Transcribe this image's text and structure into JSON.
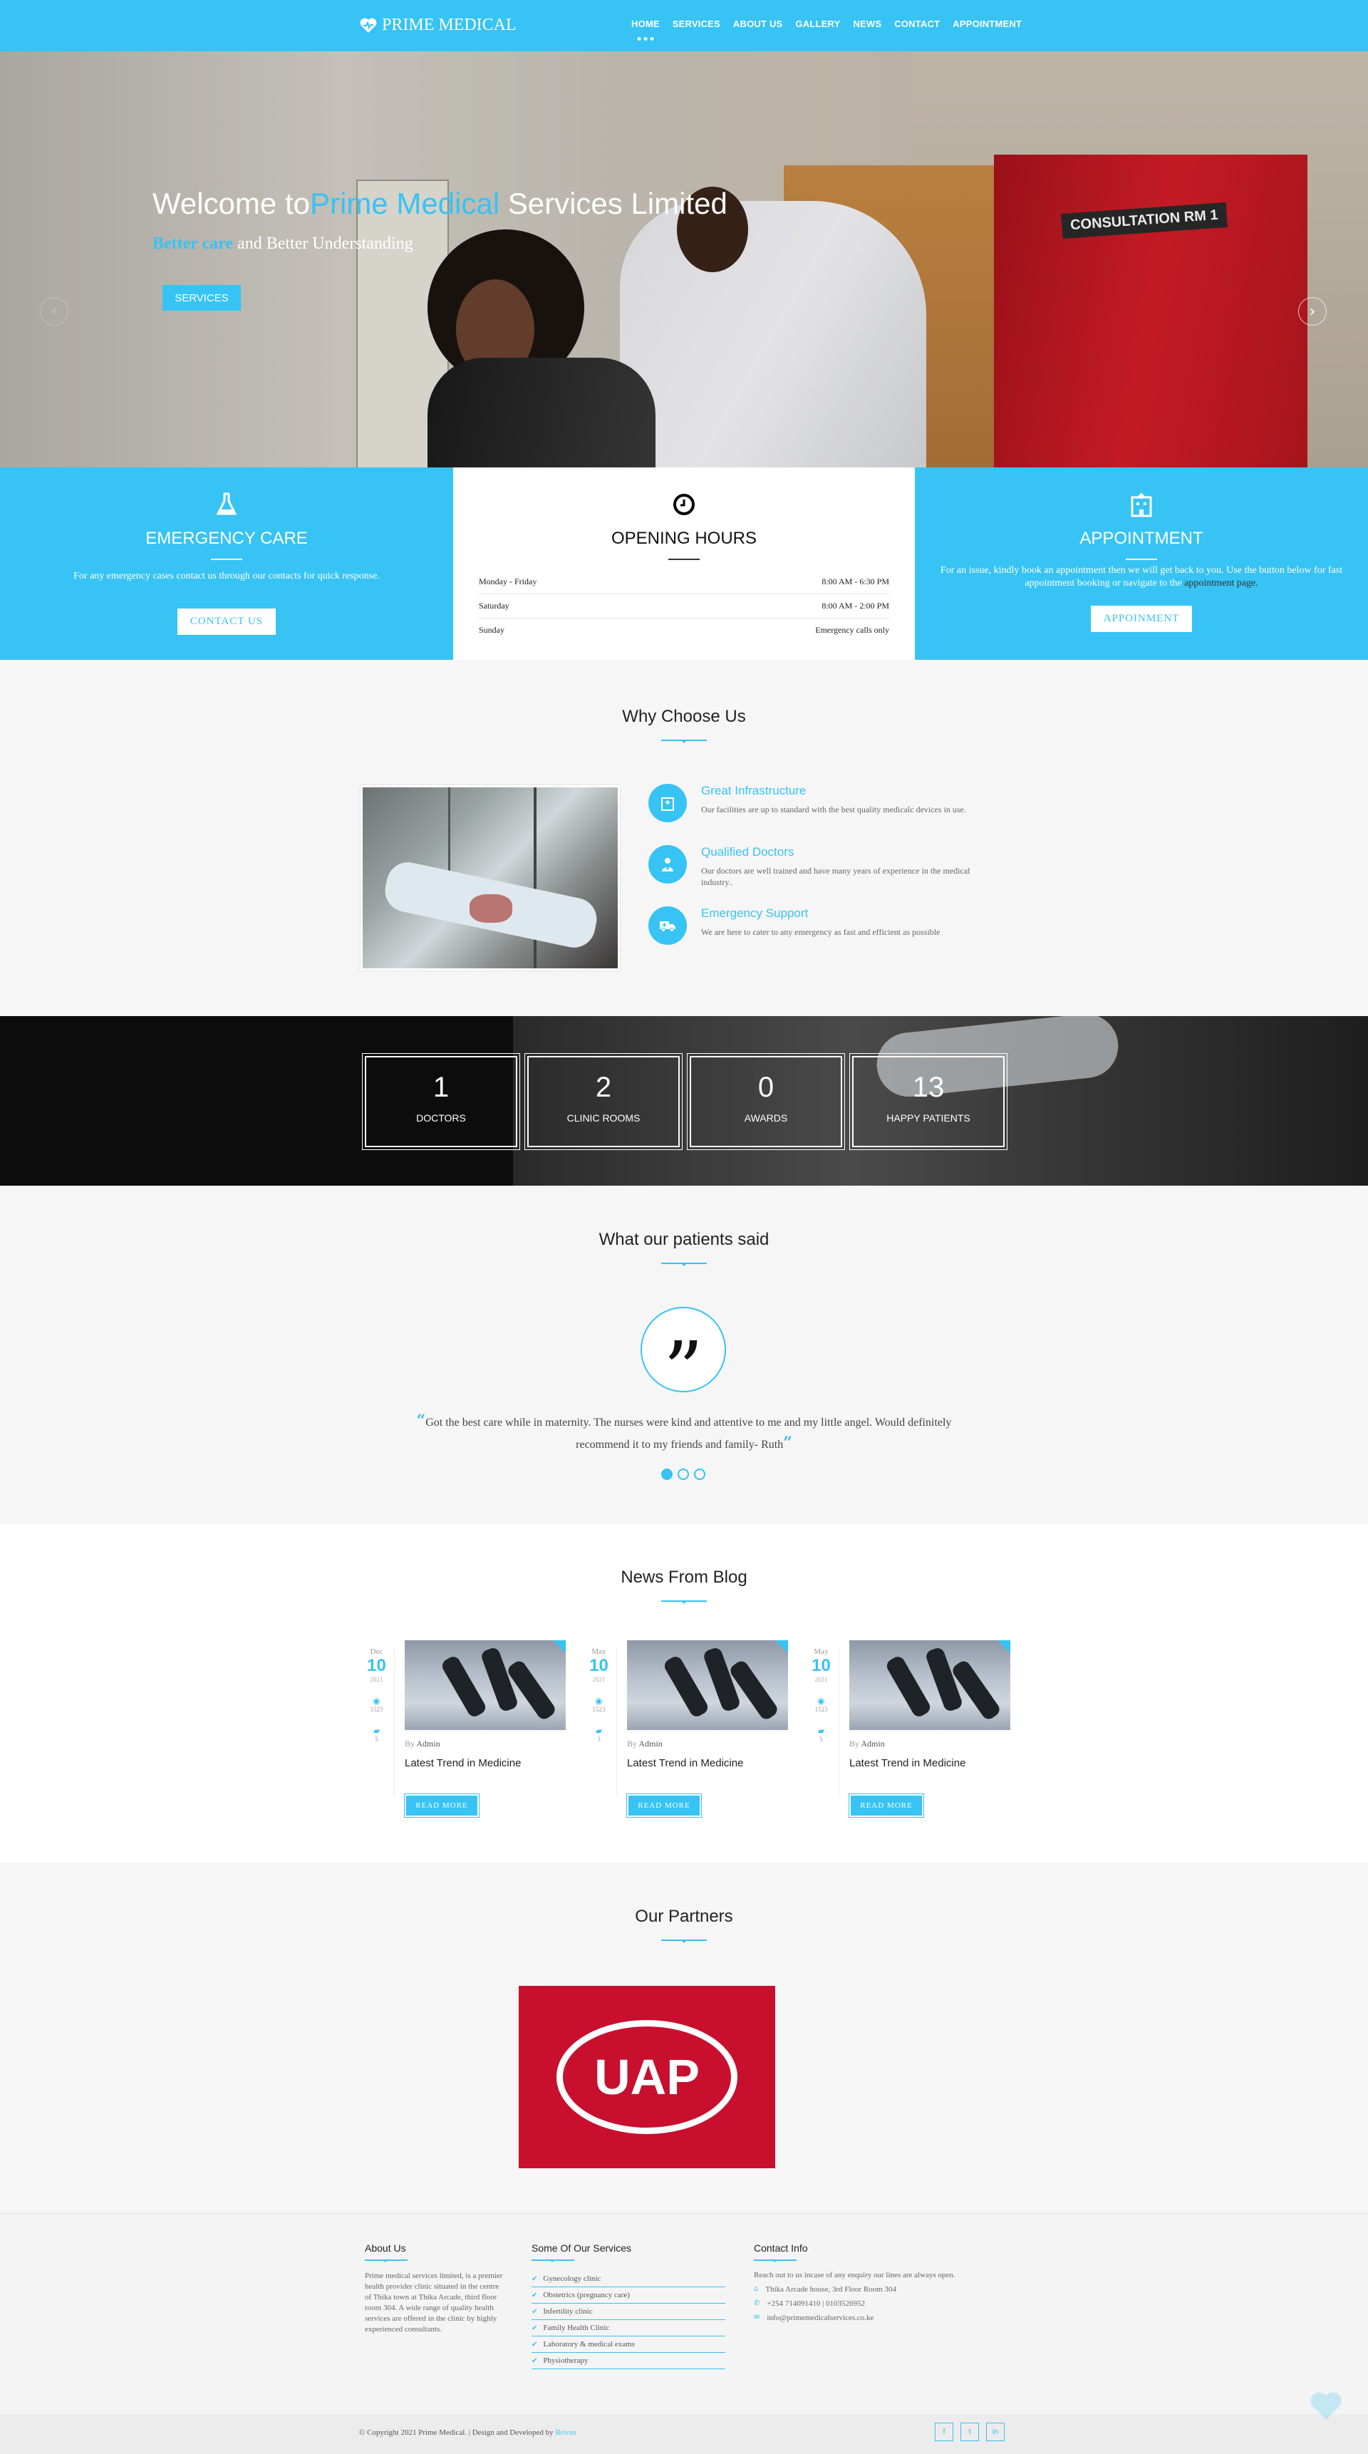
{
  "header": {
    "logo_text": "PRIME MEDICAL",
    "nav": [
      "HOME",
      "SERVICES",
      "ABOUT US",
      "GALLERY",
      "NEWS",
      "CONTACT",
      "APPOINTMENT"
    ]
  },
  "hero": {
    "title_pre": "Welcome to",
    "title_brand": "Prime Medical",
    "title_post": " Services Limited",
    "sub_hl": "Better care",
    "sub_rest": " and Better Understanding",
    "button": "SERVICES",
    "door_sign": "CONSULTATION RM 1",
    "prev_icon": "‹",
    "next_icon": "›"
  },
  "emergency": {
    "title": "EMERGENCY CARE",
    "text": "For any emergency cases contact us through our contacts for quick response.",
    "button": "CONTACT US"
  },
  "hours": {
    "title": "OPENING HOURS",
    "rows": [
      {
        "day": "Monday - Friday",
        "time": "8:00 AM - 6:30 PM"
      },
      {
        "day": "Saturday",
        "time": "8:00 AM - 2:00 PM"
      },
      {
        "day": "Sunday",
        "time": "Emergency calls only"
      }
    ]
  },
  "appointment": {
    "title": "APPOINTMENT",
    "text": "For an issue, kindly book an appointment then we will get back to you. Use the button below for fast appointment booking or navigate to the ",
    "link": "appointment page.",
    "button": "APPOINMENT"
  },
  "why": {
    "title": "Why Choose Us",
    "features": [
      {
        "title": "Great Infrastructure",
        "text": "Our facilities are up to standard with the best quality medicalc devices in use.",
        "icon": "hospital-icon"
      },
      {
        "title": "Qualified Doctors",
        "text": "Our doctors are well trained and have many years of experience in the medical industry..",
        "icon": "doctor-icon"
      },
      {
        "title": "Emergency Support",
        "text": "We are here to cater to any emergency as fast and efficient as possible",
        "icon": "ambulance-icon"
      }
    ]
  },
  "stats": [
    {
      "num": "1",
      "label": "DOCTORS"
    },
    {
      "num": "2",
      "label": "CLINIC ROOMS"
    },
    {
      "num": "0",
      "label": "AWARDS"
    },
    {
      "num": "13",
      "label": "HAPPY PATIENTS"
    }
  ],
  "testimonials": {
    "title": "What our patients said",
    "quote_mark": "”",
    "text": "Got the best care while in maternity. The nurses were kind and attentive to me and my little angel. Would definitely recommend it to my friends and family- Ruth",
    "open_q": "“",
    "close_q": "”",
    "active_dot": 1
  },
  "blog": {
    "title": "News From Blog",
    "posts": [
      {
        "month": "Dec",
        "day": "10",
        "year": "2021",
        "views": "1523",
        "comments": "5",
        "by": "By",
        "author": "Admin",
        "title": "Latest Trend in Medicine",
        "button": "READ MORE"
      },
      {
        "month": "May",
        "day": "10",
        "year": "2021",
        "views": "1523",
        "comments": "3",
        "by": "By",
        "author": "Admin",
        "title": "Latest Trend in Medicine",
        "button": "READ MORE"
      },
      {
        "month": "May",
        "day": "10",
        "year": "2021",
        "views": "1523",
        "comments": "5",
        "by": "By",
        "author": "Admin",
        "title": "Latest Trend in Medicine",
        "button": "READ MORE"
      }
    ]
  },
  "partners": {
    "title": "Our Partners",
    "logo": "UAP"
  },
  "footer": {
    "about_title": "About Us",
    "about_text": "Prime medical services limited, is a premier health provider clinic situated in the centre of Thika town at Thika Arcade, third floor room 304. A wide range of quality health services are offered in the clinic by highly experienced consultants.",
    "services_title": "Some Of Our Services",
    "services": [
      "Gynecology clinic",
      "Obstetrics (pregnancy care)",
      "Infertility clinic",
      "Family Health Clinic",
      "Laboratory & medical exams",
      "Physiotherapy"
    ],
    "contact_title": "Contact Info",
    "contact_intro": "Reach out to us incase of any enquiry our lines are always open.",
    "address": "Thika Arcade house, 3rd Floor Room 304",
    "phone": "+254 714091410 | 0103526952",
    "email": "info@primemedicalservices.co.ke",
    "copyright": "© Copyright 2021 Prime Medical. | Design and Developed by ",
    "developer": "Brivus",
    "social": [
      "f",
      "t",
      "in"
    ]
  }
}
